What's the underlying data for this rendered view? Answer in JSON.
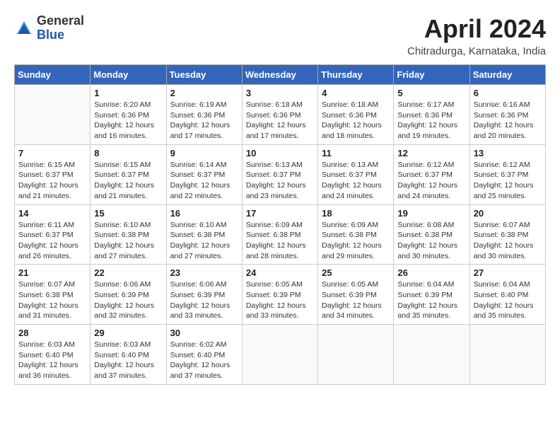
{
  "header": {
    "logo_general": "General",
    "logo_blue": "Blue",
    "month_title": "April 2024",
    "location": "Chitradurga, Karnataka, India"
  },
  "weekdays": [
    "Sunday",
    "Monday",
    "Tuesday",
    "Wednesday",
    "Thursday",
    "Friday",
    "Saturday"
  ],
  "weeks": [
    [
      {
        "day": "",
        "info": ""
      },
      {
        "day": "1",
        "info": "Sunrise: 6:20 AM\nSunset: 6:36 PM\nDaylight: 12 hours\nand 16 minutes."
      },
      {
        "day": "2",
        "info": "Sunrise: 6:19 AM\nSunset: 6:36 PM\nDaylight: 12 hours\nand 17 minutes."
      },
      {
        "day": "3",
        "info": "Sunrise: 6:18 AM\nSunset: 6:36 PM\nDaylight: 12 hours\nand 17 minutes."
      },
      {
        "day": "4",
        "info": "Sunrise: 6:18 AM\nSunset: 6:36 PM\nDaylight: 12 hours\nand 18 minutes."
      },
      {
        "day": "5",
        "info": "Sunrise: 6:17 AM\nSunset: 6:36 PM\nDaylight: 12 hours\nand 19 minutes."
      },
      {
        "day": "6",
        "info": "Sunrise: 6:16 AM\nSunset: 6:36 PM\nDaylight: 12 hours\nand 20 minutes."
      }
    ],
    [
      {
        "day": "7",
        "info": "Sunrise: 6:15 AM\nSunset: 6:37 PM\nDaylight: 12 hours\nand 21 minutes."
      },
      {
        "day": "8",
        "info": "Sunrise: 6:15 AM\nSunset: 6:37 PM\nDaylight: 12 hours\nand 21 minutes."
      },
      {
        "day": "9",
        "info": "Sunrise: 6:14 AM\nSunset: 6:37 PM\nDaylight: 12 hours\nand 22 minutes."
      },
      {
        "day": "10",
        "info": "Sunrise: 6:13 AM\nSunset: 6:37 PM\nDaylight: 12 hours\nand 23 minutes."
      },
      {
        "day": "11",
        "info": "Sunrise: 6:13 AM\nSunset: 6:37 PM\nDaylight: 12 hours\nand 24 minutes."
      },
      {
        "day": "12",
        "info": "Sunrise: 6:12 AM\nSunset: 6:37 PM\nDaylight: 12 hours\nand 24 minutes."
      },
      {
        "day": "13",
        "info": "Sunrise: 6:12 AM\nSunset: 6:37 PM\nDaylight: 12 hours\nand 25 minutes."
      }
    ],
    [
      {
        "day": "14",
        "info": "Sunrise: 6:11 AM\nSunset: 6:37 PM\nDaylight: 12 hours\nand 26 minutes."
      },
      {
        "day": "15",
        "info": "Sunrise: 6:10 AM\nSunset: 6:38 PM\nDaylight: 12 hours\nand 27 minutes."
      },
      {
        "day": "16",
        "info": "Sunrise: 6:10 AM\nSunset: 6:38 PM\nDaylight: 12 hours\nand 27 minutes."
      },
      {
        "day": "17",
        "info": "Sunrise: 6:09 AM\nSunset: 6:38 PM\nDaylight: 12 hours\nand 28 minutes."
      },
      {
        "day": "18",
        "info": "Sunrise: 6:09 AM\nSunset: 6:38 PM\nDaylight: 12 hours\nand 29 minutes."
      },
      {
        "day": "19",
        "info": "Sunrise: 6:08 AM\nSunset: 6:38 PM\nDaylight: 12 hours\nand 30 minutes."
      },
      {
        "day": "20",
        "info": "Sunrise: 6:07 AM\nSunset: 6:38 PM\nDaylight: 12 hours\nand 30 minutes."
      }
    ],
    [
      {
        "day": "21",
        "info": "Sunrise: 6:07 AM\nSunset: 6:38 PM\nDaylight: 12 hours\nand 31 minutes."
      },
      {
        "day": "22",
        "info": "Sunrise: 6:06 AM\nSunset: 6:39 PM\nDaylight: 12 hours\nand 32 minutes."
      },
      {
        "day": "23",
        "info": "Sunrise: 6:06 AM\nSunset: 6:39 PM\nDaylight: 12 hours\nand 33 minutes."
      },
      {
        "day": "24",
        "info": "Sunrise: 6:05 AM\nSunset: 6:39 PM\nDaylight: 12 hours\nand 33 minutes."
      },
      {
        "day": "25",
        "info": "Sunrise: 6:05 AM\nSunset: 6:39 PM\nDaylight: 12 hours\nand 34 minutes."
      },
      {
        "day": "26",
        "info": "Sunrise: 6:04 AM\nSunset: 6:39 PM\nDaylight: 12 hours\nand 35 minutes."
      },
      {
        "day": "27",
        "info": "Sunrise: 6:04 AM\nSunset: 6:40 PM\nDaylight: 12 hours\nand 35 minutes."
      }
    ],
    [
      {
        "day": "28",
        "info": "Sunrise: 6:03 AM\nSunset: 6:40 PM\nDaylight: 12 hours\nand 36 minutes."
      },
      {
        "day": "29",
        "info": "Sunrise: 6:03 AM\nSunset: 6:40 PM\nDaylight: 12 hours\nand 37 minutes."
      },
      {
        "day": "30",
        "info": "Sunrise: 6:02 AM\nSunset: 6:40 PM\nDaylight: 12 hours\nand 37 minutes."
      },
      {
        "day": "",
        "info": ""
      },
      {
        "day": "",
        "info": ""
      },
      {
        "day": "",
        "info": ""
      },
      {
        "day": "",
        "info": ""
      }
    ]
  ]
}
